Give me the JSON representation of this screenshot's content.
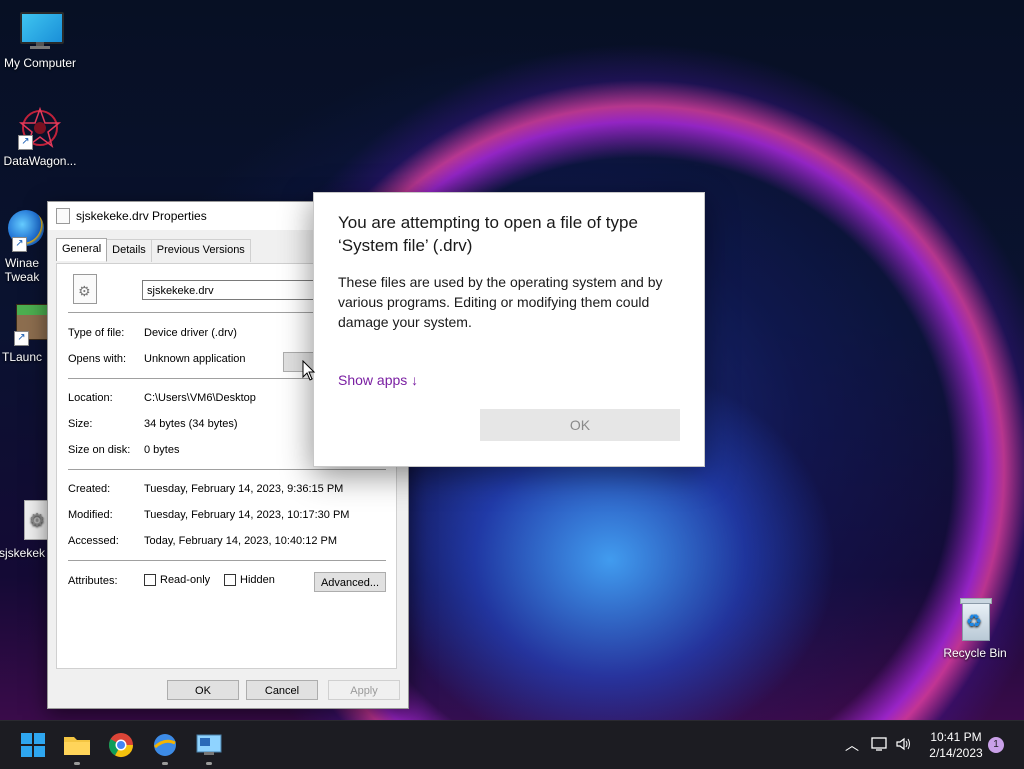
{
  "desktop": {
    "icons": [
      {
        "label": "My Computer"
      },
      {
        "label": "DataWagon..."
      },
      {
        "label": "Winae\nTweak"
      },
      {
        "label": "TLaunc"
      },
      {
        "label": "sjskekek"
      },
      {
        "label": "Recycle Bin"
      }
    ]
  },
  "properties": {
    "title": "sjskekeke.drv Properties",
    "tabs": [
      "General",
      "Details",
      "Previous Versions"
    ],
    "filename": "sjskekeke.drv",
    "type_label": "Type of file:",
    "type_value": "Device driver (.drv)",
    "opens_label": "Opens with:",
    "opens_value": "Unknown application",
    "location_label": "Location:",
    "location_value": "C:\\Users\\VM6\\Desktop",
    "size_label": "Size:",
    "size_value": "34 bytes (34 bytes)",
    "disk_label": "Size on disk:",
    "disk_value": "0 bytes",
    "created_label": "Created:",
    "created_value": "Tuesday, February 14, 2023, 9:36:15 PM",
    "modified_label": "Modified:",
    "modified_value": "Tuesday, February 14, 2023, 10:17:30 PM",
    "accessed_label": "Accessed:",
    "accessed_value": "Today, February 14, 2023, 10:40:12 PM",
    "attributes_label": "Attributes:",
    "readonly_label": "Read-only",
    "hidden_label": "Hidden",
    "advanced_label": "Advanced...",
    "ok_label": "OK",
    "cancel_label": "Cancel",
    "apply_label": "Apply"
  },
  "dialog": {
    "title": "You are attempting to open a file of type ‘System file’ (.drv)",
    "body": "These files are used by the operating system and by various programs. Editing or modifying them could damage your system.",
    "show_apps": "Show apps ↓",
    "ok_label": "OK"
  },
  "taskbar": {
    "time": "10:41 PM",
    "date": "2/14/2023",
    "notification_count": "1"
  },
  "colors": {
    "accent_link": "#7a1fa2",
    "taskbar": "#1c1c22"
  }
}
